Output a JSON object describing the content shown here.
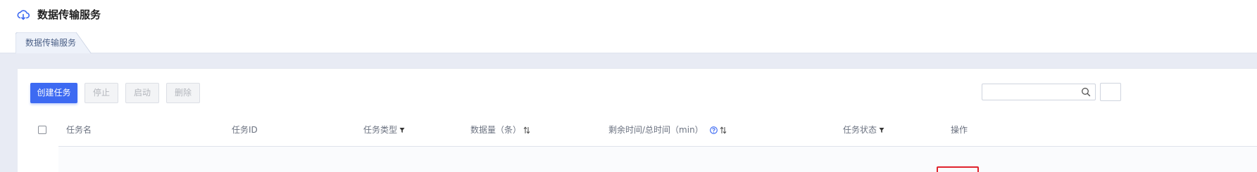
{
  "app": {
    "title": "数据传输服务"
  },
  "tabs": [
    {
      "label": "数据传输服务"
    }
  ],
  "toolbar": {
    "create_label": "创建任务",
    "stop_label": "停止",
    "start_label": "启动",
    "delete_label": "删除"
  },
  "search": {
    "value": "",
    "placeholder": ""
  },
  "table": {
    "columns": {
      "name": "任务名",
      "id": "任务ID",
      "type": "任务类型",
      "volume": "数据量（条）",
      "time": "剩余时间/总时间（min）",
      "status": "任务状态",
      "actions": "操作"
    }
  },
  "colors": {
    "primary": "#3d6af2",
    "highlight": "#e0222c",
    "background_band": "#e8ebf4"
  },
  "icons": [
    "cloud-transfer-icon",
    "search-icon",
    "filter-icon",
    "sort-icon",
    "help-icon"
  ]
}
